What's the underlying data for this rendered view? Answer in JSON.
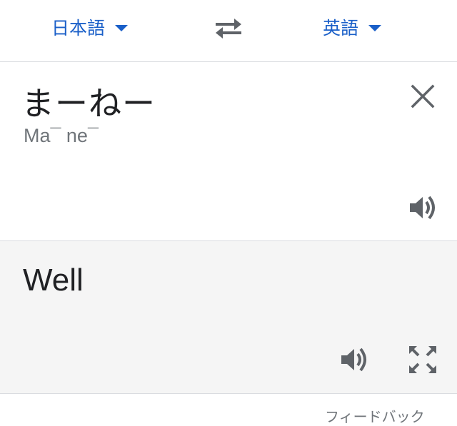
{
  "languages": {
    "source_label": "日本語",
    "target_label": "英語"
  },
  "source": {
    "text": "まーねー",
    "romanization": "Ma¯ ne¯"
  },
  "translation": {
    "text": "Well"
  },
  "footer": {
    "feedback_label": "フィードバック"
  },
  "icons": {
    "swap": "swap-arrows-icon",
    "clear": "close-icon",
    "speaker": "speaker-icon",
    "fullscreen": "fullscreen-icon",
    "caret": "caret-down-icon"
  },
  "colors": {
    "accent": "#1a5fc8",
    "result_background": "#f5f5f5",
    "icon_gray": "#5f6368"
  }
}
